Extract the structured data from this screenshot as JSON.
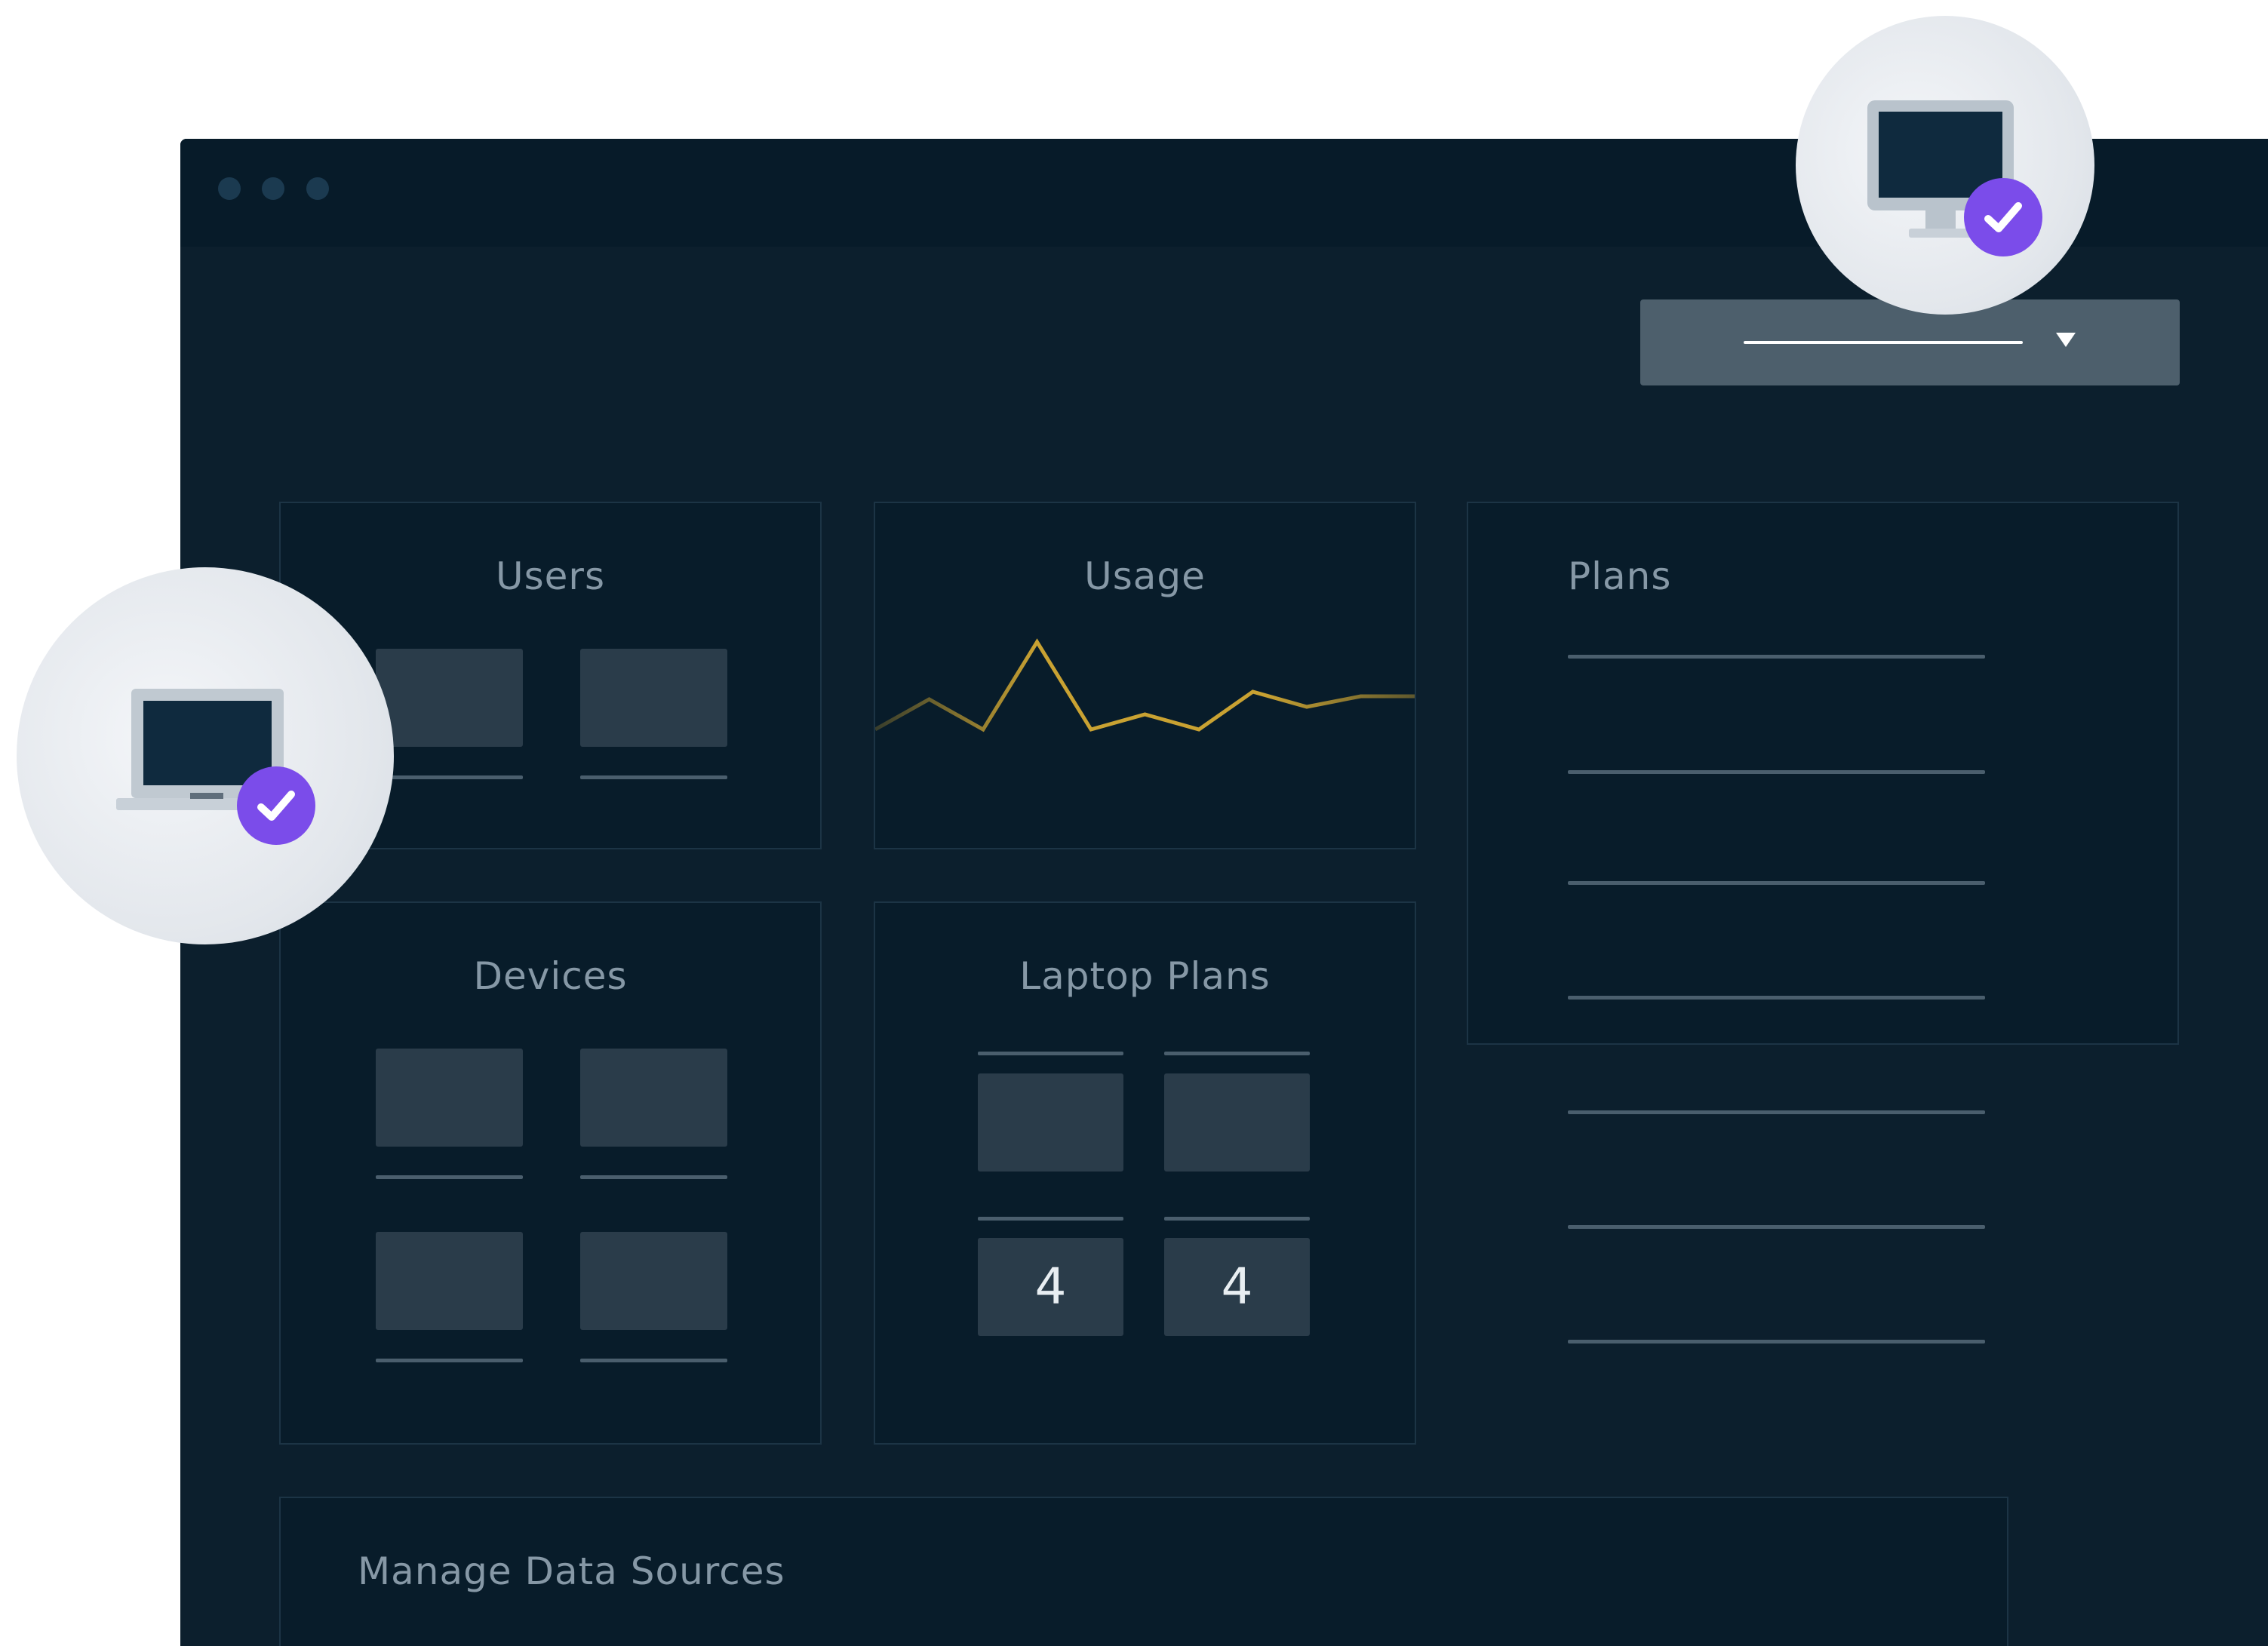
{
  "window": {
    "controls": [
      "dot",
      "dot",
      "dot"
    ]
  },
  "toolbar": {
    "dropdown_icon": "chevron-down-icon"
  },
  "cards": {
    "users": {
      "title": "Users"
    },
    "usage": {
      "title": "Usage",
      "chart_color": "#c9a232"
    },
    "plans": {
      "title": "Plans",
      "lines": 7
    },
    "devices": {
      "title": "Devices"
    },
    "laptop_plans": {
      "title": "Laptop Plans",
      "values": [
        "4",
        "4"
      ]
    },
    "data_sources": {
      "title": "Manage Data Sources"
    }
  },
  "badges": {
    "icon": "checkmark-icon",
    "color": "#7b4cea"
  },
  "chart_data": {
    "type": "line",
    "x": [
      0,
      1,
      2,
      3,
      4,
      5,
      6,
      7,
      8,
      9,
      10
    ],
    "values": [
      2,
      4,
      2,
      7.8,
      2,
      3,
      2,
      4.5,
      3.5,
      4.2,
      4.2
    ],
    "title": "Usage",
    "grid": false
  }
}
